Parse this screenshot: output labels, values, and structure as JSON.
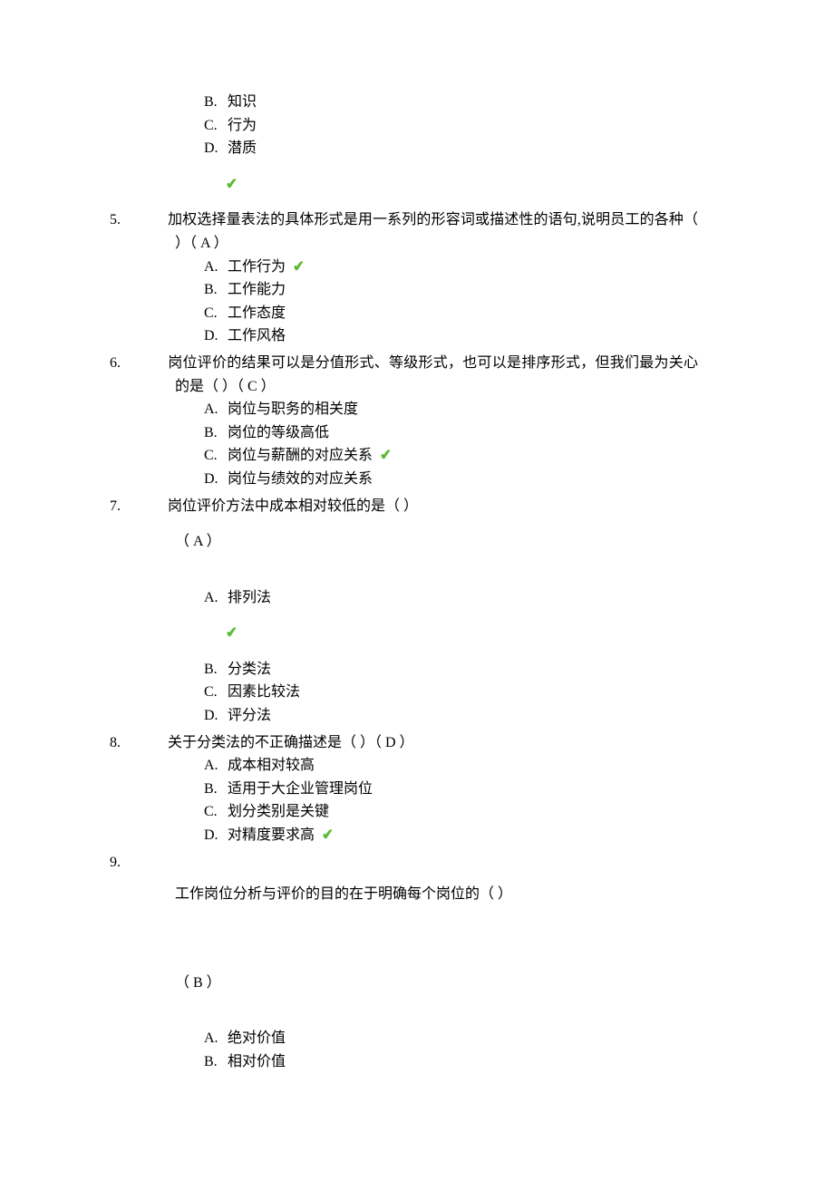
{
  "q4_options": {
    "B": {
      "letter": "B.",
      "text": "知识"
    },
    "C": {
      "letter": "C.",
      "text": "行为"
    },
    "D": {
      "letter": "D.",
      "text": "潜质"
    }
  },
  "q5": {
    "num": "5.",
    "stem": "加权选择量表法的具体形式是用一系列的形容词或描述性的语句,说明员工的各种（ ）（ A ）",
    "options": {
      "A": {
        "letter": "A.",
        "text": "工作行为"
      },
      "B": {
        "letter": "B.",
        "text": "工作能力"
      },
      "C": {
        "letter": "C.",
        "text": "工作态度"
      },
      "D": {
        "letter": "D.",
        "text": "工作风格"
      }
    }
  },
  "q6": {
    "num": "6.",
    "stem": "岗位评价的结果可以是分值形式、等级形式，也可以是排序形式，但我们最为关心的是（ ）（ C ）",
    "options": {
      "A": {
        "letter": "A.",
        "text": "岗位与职务的相关度"
      },
      "B": {
        "letter": "B.",
        "text": "岗位的等级高低"
      },
      "C": {
        "letter": "C.",
        "text": "岗位与薪酬的对应关系"
      },
      "D": {
        "letter": "D.",
        "text": "岗位与绩效的对应关系"
      }
    }
  },
  "q7": {
    "num": "7.",
    "stem": "岗位评价方法中成本相对较低的是（ ）",
    "answer": "（ A ）",
    "options": {
      "A": {
        "letter": "A.",
        "text": "排列法"
      },
      "B": {
        "letter": "B.",
        "text": "分类法"
      },
      "C": {
        "letter": "C.",
        "text": "因素比较法"
      },
      "D": {
        "letter": "D.",
        "text": "评分法"
      }
    }
  },
  "q8": {
    "num": "8.",
    "stem": "关于分类法的不正确描述是（ ）（ D ）",
    "options": {
      "A": {
        "letter": "A.",
        "text": "成本相对较高"
      },
      "B": {
        "letter": "B.",
        "text": "适用于大企业管理岗位"
      },
      "C": {
        "letter": "C.",
        "text": "划分类别是关键"
      },
      "D": {
        "letter": "D.",
        "text": "对精度要求高"
      }
    }
  },
  "q9": {
    "num": "9.",
    "stem": "工作岗位分析与评价的目的在于明确每个岗位的（ ）",
    "answer": "（ B ）",
    "options": {
      "A": {
        "letter": "A.",
        "text": "绝对价值"
      },
      "B": {
        "letter": "B.",
        "text": "相对价值"
      }
    }
  },
  "checkmark": "✔"
}
